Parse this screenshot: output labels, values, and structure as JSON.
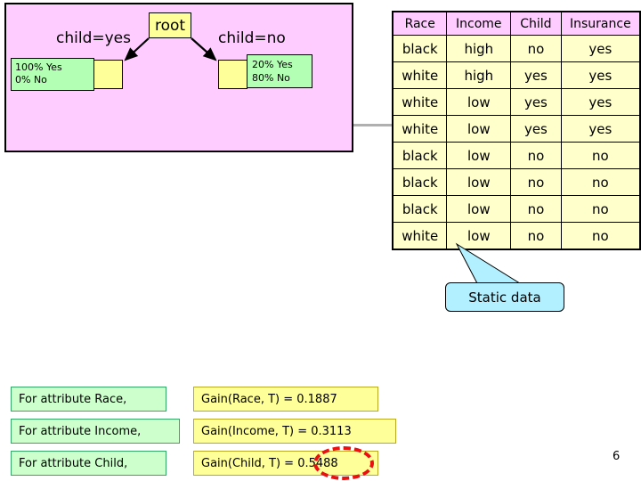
{
  "tree": {
    "root_label": "root",
    "edge_left_label": "child=yes",
    "edge_right_label": "child=no",
    "leaf_left": {
      "line1": "100% Yes",
      "line2": "0% No"
    },
    "leaf_right": {
      "line1": "20% Yes",
      "line2": "80% No"
    },
    "panel_color": "#ffccff",
    "node_color": "#ffff99",
    "stats_color": "#b3ffb3"
  },
  "table": {
    "headers": [
      "Race",
      "Income",
      "Child",
      "Insurance"
    ],
    "header_color": "#ffccff",
    "cell_color": "#ffffcc",
    "rows": [
      [
        "black",
        "high",
        "no",
        "yes"
      ],
      [
        "white",
        "high",
        "yes",
        "yes"
      ],
      [
        "white",
        "low",
        "yes",
        "yes"
      ],
      [
        "white",
        "low",
        "yes",
        "yes"
      ],
      [
        "black",
        "low",
        "no",
        "no"
      ],
      [
        "black",
        "low",
        "no",
        "no"
      ],
      [
        "black",
        "low",
        "no",
        "no"
      ],
      [
        "white",
        "low",
        "no",
        "no"
      ]
    ]
  },
  "callout": {
    "text": "Static data",
    "color": "#b3f0ff"
  },
  "gains": [
    {
      "label": "For attribute Race,",
      "gain": "Gain(Race, T) = 0.1887",
      "highlighted": false
    },
    {
      "label": "For attribute Income,",
      "gain": "Gain(Income, T) = 0.3113",
      "highlighted": false
    },
    {
      "label": "For attribute Child,",
      "gain": "Gain(Child, T) = 0.5488",
      "highlighted": true
    }
  ],
  "highlight_color": "#e81010",
  "page_number": "6"
}
